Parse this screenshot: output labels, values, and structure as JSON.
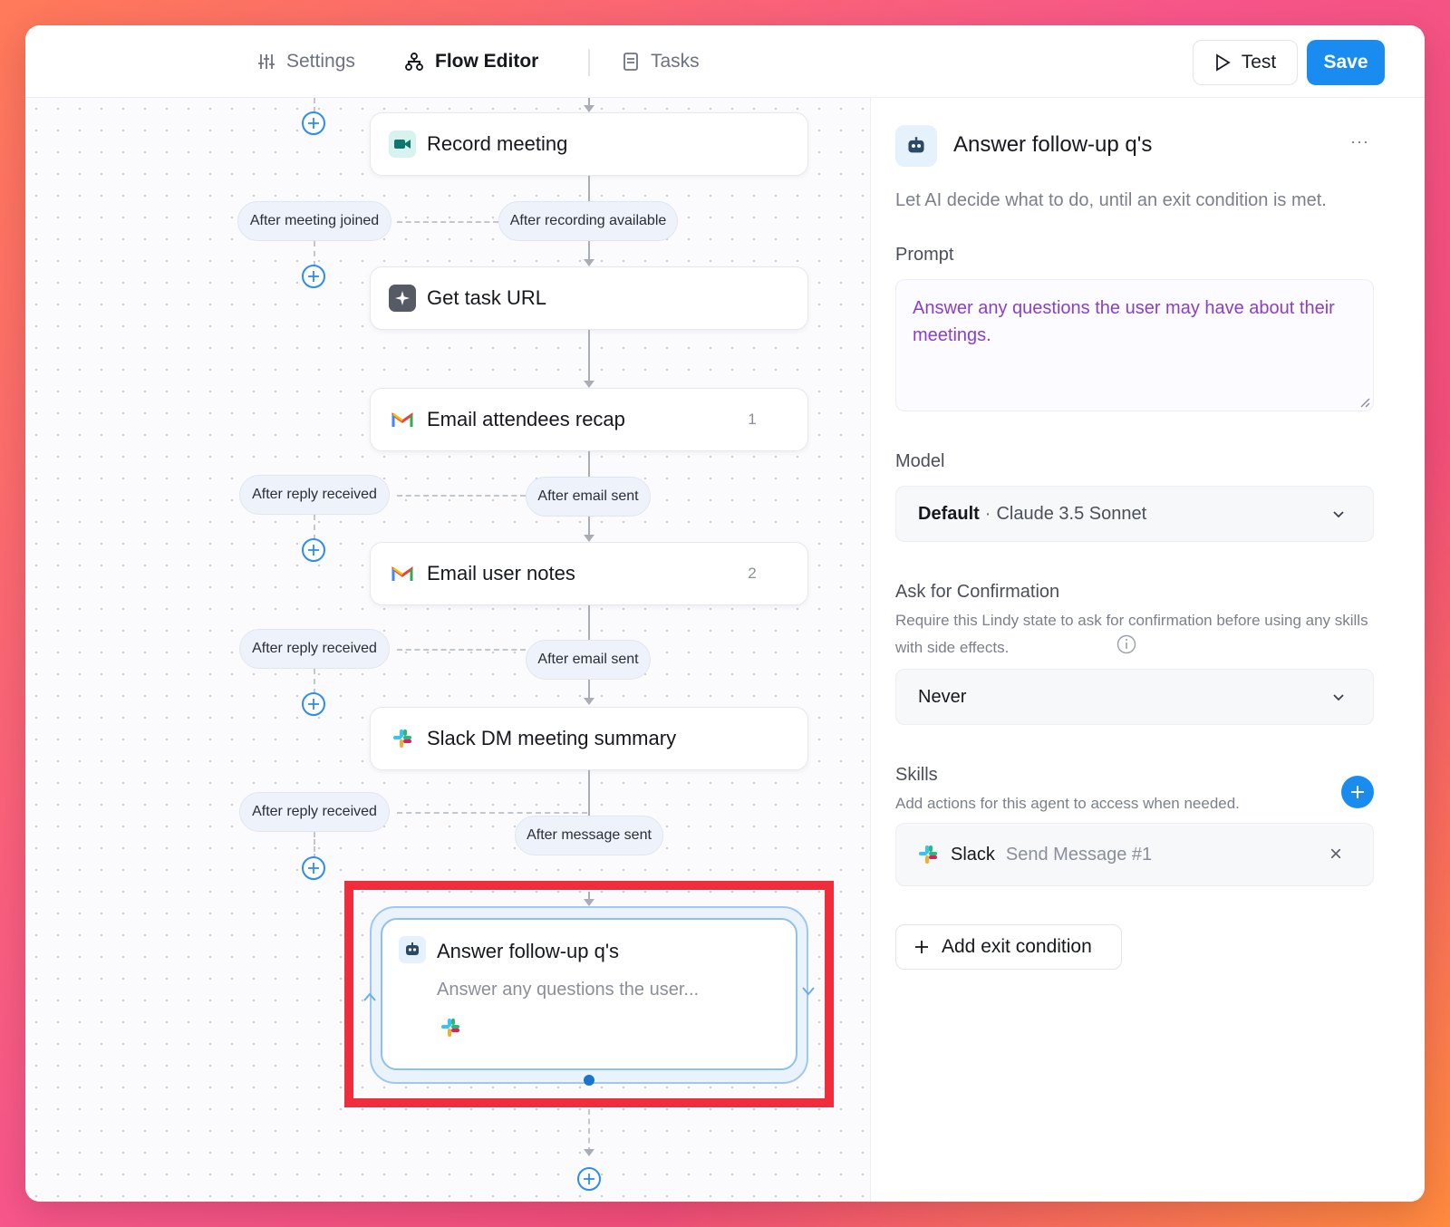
{
  "nav": {
    "settings": "Settings",
    "flow_editor": "Flow Editor",
    "tasks": "Tasks",
    "test": "Test",
    "save": "Save"
  },
  "flow": {
    "nodes": [
      {
        "title": "Record meeting",
        "icon": "video-camera-icon"
      },
      {
        "title": "Get task URL",
        "icon": "sparkle-icon"
      },
      {
        "title": "Email attendees recap",
        "icon": "gmail-icon",
        "count": "1"
      },
      {
        "title": "Email user notes",
        "icon": "gmail-icon",
        "count": "2"
      },
      {
        "title": "Slack DM meeting summary",
        "icon": "slack-icon"
      }
    ],
    "branches": {
      "after_meeting_joined": "After meeting joined",
      "after_recording_available": "After recording available",
      "after_reply_received_1": "After reply received",
      "after_email_sent_1": "After email sent",
      "after_reply_received_2": "After reply received",
      "after_email_sent_2": "After email sent",
      "after_reply_received_3": "After reply received",
      "after_message_sent": "After message sent"
    },
    "agent_node": {
      "title": "Answer follow-up q's",
      "subtitle": "Answer any questions the user...",
      "icon": "robot-icon",
      "skill_icon": "slack-icon"
    }
  },
  "panel": {
    "title": "Answer follow-up q's",
    "more": "···",
    "description": "Let AI decide what to do, until an exit condition is met.",
    "prompt_label": "Prompt",
    "prompt_value": "Answer any questions the user may have about their meetings.",
    "model_label": "Model",
    "model_default": "Default",
    "model_sep": "·",
    "model_name": "Claude 3.5 Sonnet",
    "confirm_label": "Ask for Confirmation",
    "confirm_desc": "Require this Lindy state to ask for confirmation before using any skills with side effects.",
    "confirm_value": "Never",
    "skills_label": "Skills",
    "skills_desc": "Add actions for this agent to access when needed.",
    "skill_app": "Slack",
    "skill_action": "Send Message #1",
    "remove": "×",
    "add_exit": "Add exit condition"
  },
  "colors": {
    "accent": "#1a8cf0",
    "highlight": "#ef2d3d",
    "prompt_text": "#8a3fc8"
  }
}
